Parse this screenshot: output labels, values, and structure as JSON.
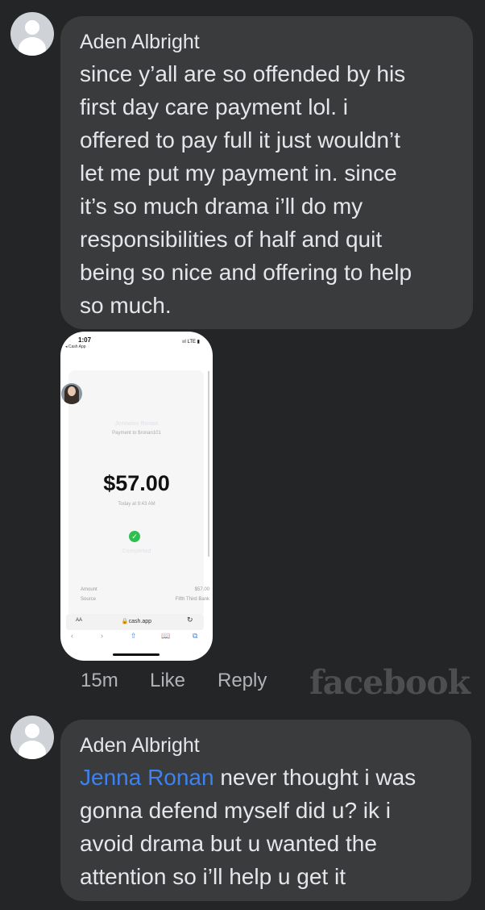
{
  "comments": [
    {
      "author": "Aden Albright",
      "text_lines": [
        "since y’all are so offended by his",
        "first day care payment lol. i",
        "offered to pay full it just wouldn’t",
        "let me put my payment in. since",
        "it’s so much drama i’ll do my",
        "responsibilities of half and quit",
        "being so nice and offering to help",
        "so much."
      ]
    },
    {
      "author": "Aden Albright",
      "mention": "Jenna Ronan",
      "line1_rest": " never thought i was",
      "text_lines": [
        "gonna defend myself did u? ik i",
        "avoid drama but u wanted the",
        "attention so i’ll help u get it"
      ]
    }
  ],
  "attachment": {
    "status_time": "1:07",
    "back_app": "◂ Cash App",
    "signal": "ııl LTE ▮",
    "recipient": "Jennalee Ronan",
    "subtitle": "Payment to $ronan101",
    "amount": "$57.00",
    "time": "Today at 9:43 AM",
    "status": "Completed",
    "rows": [
      {
        "label": "Amount",
        "value": "$57.00"
      },
      {
        "label": "Source",
        "value": "Fifth Third Bank"
      }
    ],
    "aa": "AA",
    "url": "🔒cash.app",
    "reload": "↻",
    "nav": [
      "‹",
      "›",
      "⇧",
      "📖",
      "⧉"
    ]
  },
  "actions": {
    "time": "15m",
    "like": "Like",
    "reply": "Reply"
  },
  "watermark": "facebook"
}
